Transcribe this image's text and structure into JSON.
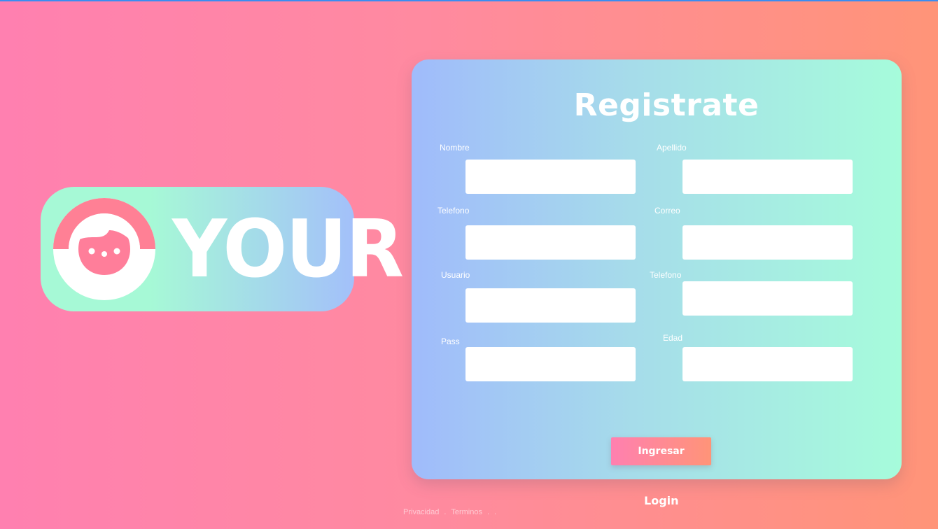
{
  "logo": {
    "text": "YOUR",
    "icon": "face-icon"
  },
  "form": {
    "title": "Registrate",
    "fields": {
      "nombre": {
        "label": "Nombre",
        "value": ""
      },
      "apellido": {
        "label": "Apellido",
        "value": ""
      },
      "telefono1": {
        "label": "Telefono",
        "value": ""
      },
      "correo": {
        "label": "Correo",
        "value": ""
      },
      "usuario": {
        "label": "Usuario",
        "value": ""
      },
      "telefono2": {
        "label": "Telefono",
        "value": ""
      },
      "pass": {
        "label": "Pass",
        "value": ""
      },
      "edad": {
        "label": "Edad",
        "value": ""
      }
    },
    "submit_label": "Ingresar"
  },
  "login_link": "Login",
  "footer": {
    "privacy": "Privacidad",
    "sep1": ".",
    "terms": "Terminos",
    "sep2": ".",
    "sep3": "."
  },
  "colors": {
    "background_start": "#ff80b0",
    "background_end": "#ff9478",
    "card_start": "#a0bbfb",
    "card_end": "#a6fcdb",
    "accent_pink": "#ff7e9a"
  }
}
